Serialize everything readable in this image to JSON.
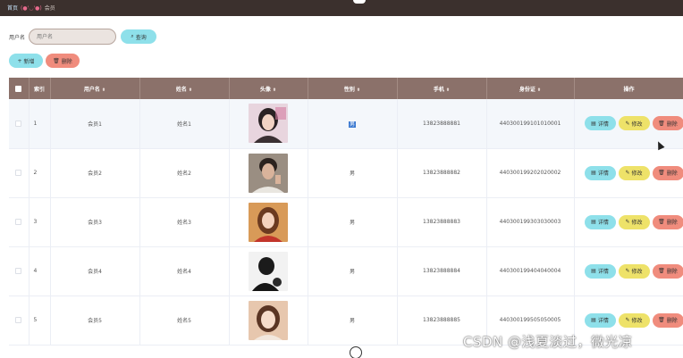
{
  "breadcrumb": {
    "home": "首页",
    "separator": "(●'◡'●)",
    "current": "会员"
  },
  "search": {
    "label": "用户名",
    "placeholder": "用户名",
    "value": "",
    "button": "查询"
  },
  "actions": {
    "add": "新增",
    "delete": "删除"
  },
  "table": {
    "headers": [
      "索引",
      "用户名",
      "姓名",
      "头像",
      "性别",
      "手机",
      "身份证",
      "操作"
    ],
    "rows": [
      {
        "index": "1",
        "username": "会员1",
        "name": "姓名1",
        "gender": "男",
        "phone": "13823888881",
        "id_card": "440300199101010001"
      },
      {
        "index": "2",
        "username": "会员2",
        "name": "姓名2",
        "gender": "男",
        "phone": "13823888882",
        "id_card": "440300199202020002"
      },
      {
        "index": "3",
        "username": "会员3",
        "name": "姓名3",
        "gender": "男",
        "phone": "13823888883",
        "id_card": "440300199303030003"
      },
      {
        "index": "4",
        "username": "会员4",
        "name": "姓名4",
        "gender": "男",
        "phone": "13823888884",
        "id_card": "440300199404040004"
      },
      {
        "index": "5",
        "username": "会员5",
        "name": "姓名5",
        "gender": "男",
        "phone": "13823888885",
        "id_card": "440300199505050005"
      }
    ],
    "row_actions": {
      "detail": "详情",
      "edit": "修改",
      "remove": "删除"
    }
  },
  "watermark": "CSDN @浅夏淡过，微光凉",
  "colors": {
    "header_bg": "#8b716a",
    "topbar_bg": "#3b302d",
    "detail": "#8ee0ea",
    "edit": "#eee269",
    "remove": "#f08c7d"
  }
}
